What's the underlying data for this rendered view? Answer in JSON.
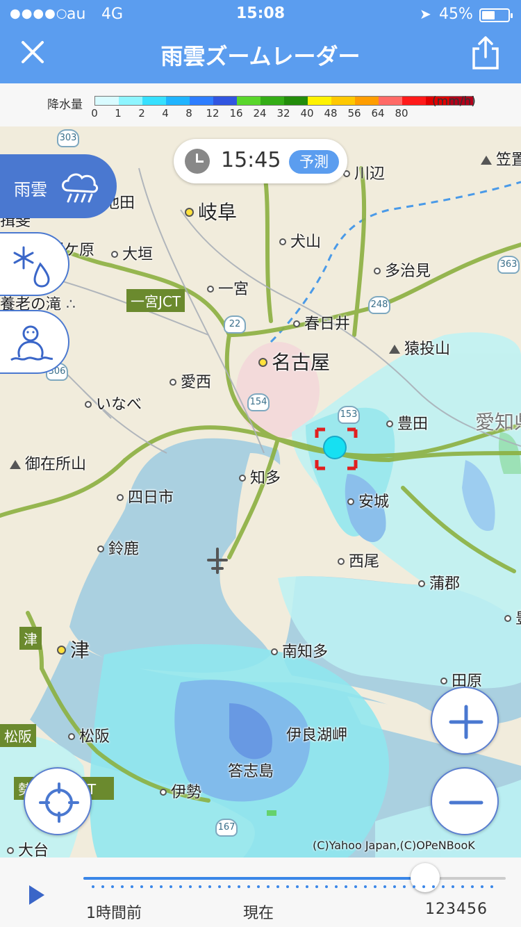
{
  "status_bar": {
    "signal": "●●●●○",
    "carrier": "au",
    "network": "4G",
    "time": "15:08",
    "location_icon": "➤",
    "battery_percent": "45%",
    "battery_level": 0.45
  },
  "header": {
    "title": "雨雲ズームレーダー",
    "close_icon": "close-icon",
    "share_icon": "share-icon"
  },
  "legend": {
    "title": "降水量",
    "unit": "(mm/h)",
    "colors": [
      "#d9fbff",
      "#8ef5ff",
      "#36e0ff",
      "#1fb4ff",
      "#2d7dff",
      "#3155e0",
      "#59d62b",
      "#34ad16",
      "#228c0a",
      "#fff200",
      "#ffc800",
      "#ff9d00",
      "#ff6a66",
      "#ff1a1a",
      "#e00000",
      "#b3001a"
    ],
    "ticks": [
      "0",
      "1",
      "2",
      "4",
      "8",
      "12",
      "16",
      "24",
      "32",
      "40",
      "48",
      "56",
      "64",
      "80"
    ]
  },
  "time_pill": {
    "time": "15:45",
    "tag": "予測"
  },
  "layers": {
    "rain_label": "雨雲",
    "snow_icon": "snow-rain-icon",
    "snowman_icon": "snowman-icon"
  },
  "places": {
    "kawabe": "川辺",
    "kasagi": "笠置",
    "gifu": "岐阜",
    "inuyama": "犬山",
    "ogaki": "大垣",
    "tajimi": "多治見",
    "ichinomiya": "一宮",
    "kasugai": "春日井",
    "sanageyama": "猿投山",
    "nagoya": "名古屋",
    "aisai": "愛西",
    "inabe": "いなべ",
    "toyota": "豊田",
    "aichi_ken": "愛知県",
    "gozaisho": "御在所山",
    "chita": "知多",
    "yokkaichi": "四日市",
    "anjo": "安城",
    "suzuka": "鈴鹿",
    "nishio": "西尾",
    "gamagori": "蒲郡",
    "tsu": "津",
    "minamichita": "南知多",
    "tahara": "田原",
    "matsusaka": "松阪",
    "iragomisaki": "伊良湖岬",
    "toshijima": "答志島",
    "ise": "伊勢",
    "odai": "大台",
    "yoro": "養老の滝",
    "sekigahara": "関ケ原",
    "ibi": "揖斐",
    "ikeda": "池田",
    "toyo_partial": "豊"
  },
  "tags": {
    "ichinomiya_jct": "一宮JCT",
    "tsu_tag": "津",
    "matsusaka_tag": "松阪",
    "seiwa_jct": "勢和多気JCT"
  },
  "shields": {
    "r303": "303",
    "r22": "22",
    "r248": "248",
    "r363": "363",
    "r154": "154",
    "r153": "153",
    "r306": "306",
    "r167": "167"
  },
  "controls": {
    "zoom_in": "+",
    "zoom_out": "−",
    "locate_icon": "crosshair-icon"
  },
  "copyright": "(C)Yahoo Japan,(C)OPeNBooK",
  "timeline": {
    "play_icon": "play-icon",
    "past_label": "1時間前",
    "now_label": "現在",
    "future_labels": "123456",
    "progress": 0.81
  }
}
